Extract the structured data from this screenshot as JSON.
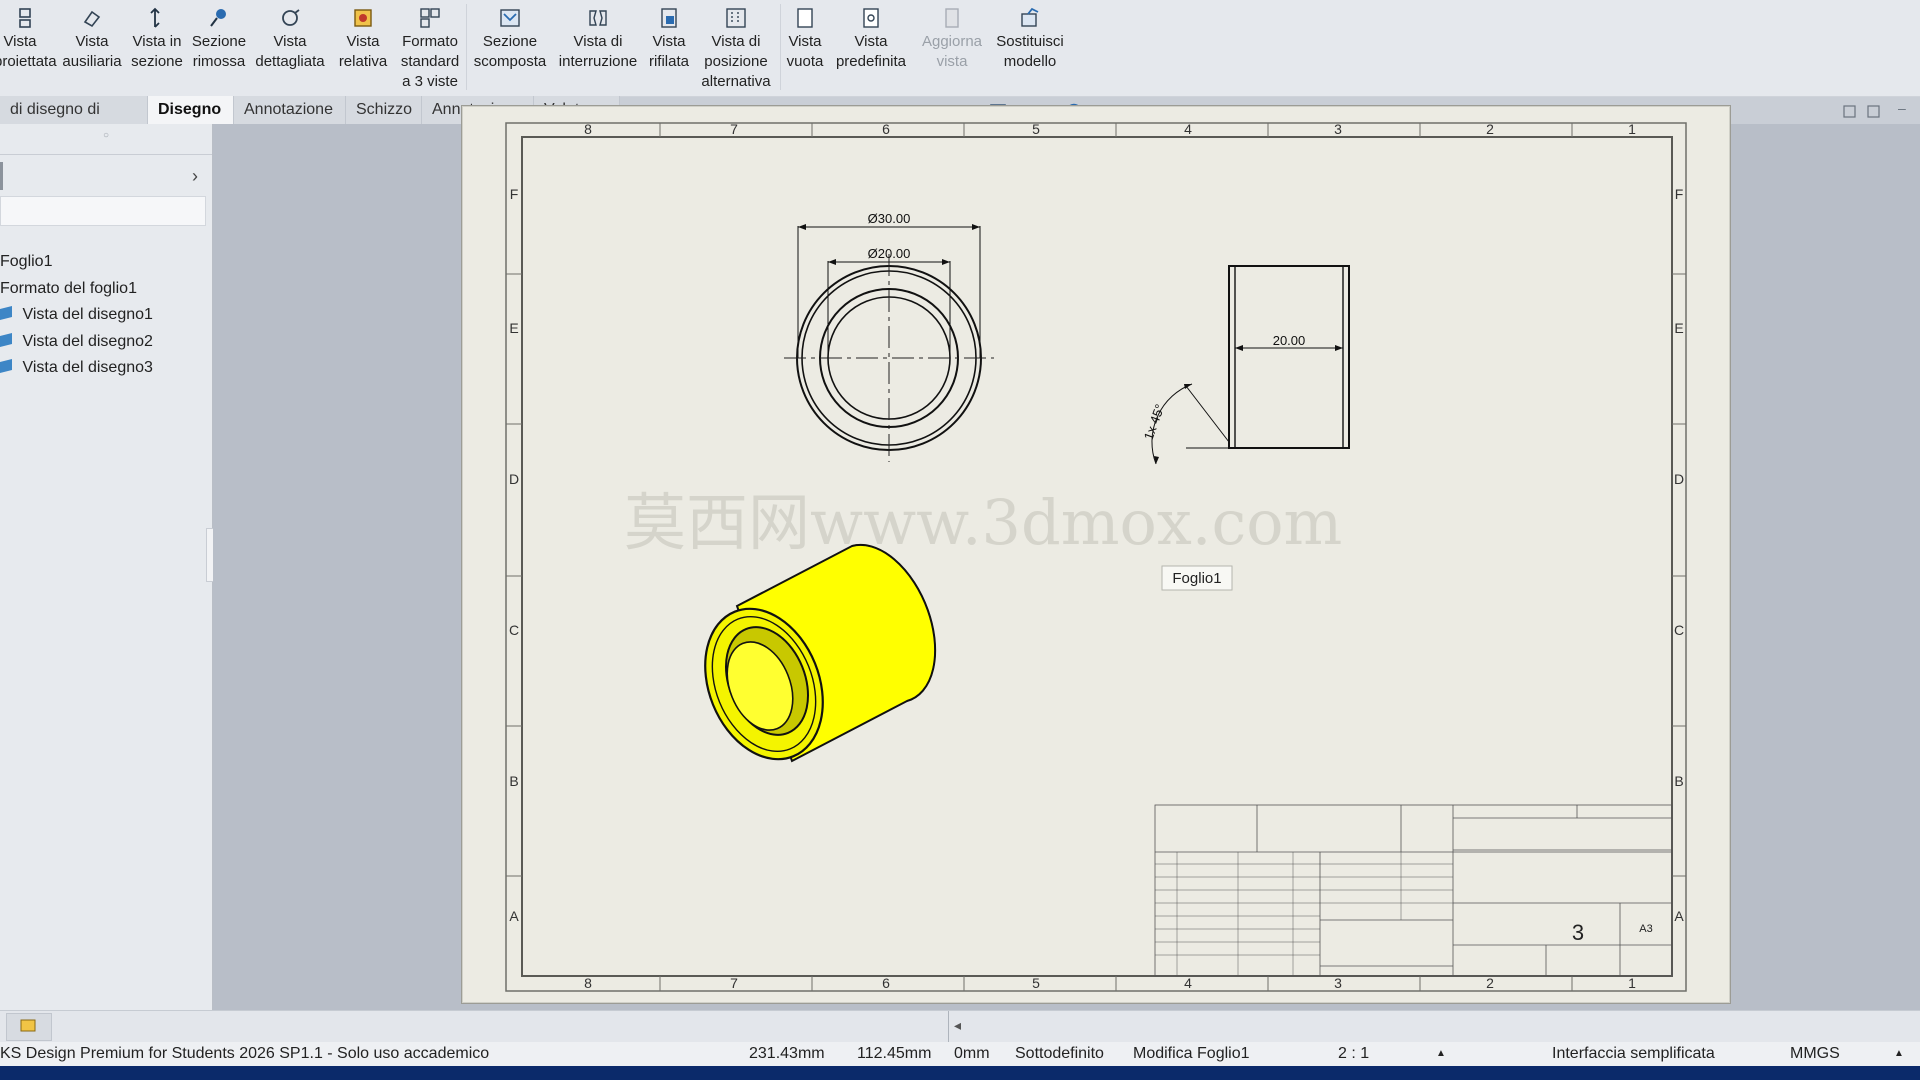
{
  "ribbon": {
    "buttons": [
      {
        "label": "Vista\nproiettata",
        "icon": "projected-view-icon"
      },
      {
        "label": "Vista\nausiliaria",
        "icon": "auxiliary-view-icon"
      },
      {
        "label": "Vista in\nsezione",
        "icon": "section-view-icon"
      },
      {
        "label": "Sezione\nrimossa",
        "icon": "removed-section-icon"
      },
      {
        "label": "Vista\ndettagliata",
        "icon": "detail-view-icon"
      },
      {
        "label": "Vista\nrelativa",
        "icon": "relative-view-icon"
      },
      {
        "label": "Formato\nstandard\na 3 viste",
        "icon": "standard-3-view-icon"
      },
      {
        "label": "Sezione\nscomposta",
        "icon": "broken-out-section-icon"
      },
      {
        "label": "Vista di\ninterruzione",
        "icon": "break-view-icon"
      },
      {
        "label": "Vista\nrifilata",
        "icon": "crop-view-icon"
      },
      {
        "label": "Vista di\nposizione\nalternativa",
        "icon": "alternate-position-view-icon"
      },
      {
        "label": "Vista\nvuota",
        "icon": "empty-view-icon"
      },
      {
        "label": "Vista\npredefinita",
        "icon": "predefined-view-icon"
      },
      {
        "label": "Aggiorna\nvista",
        "icon": "update-view-icon"
      },
      {
        "label": "Sostituisci\nmodello",
        "icon": "replace-model-icon"
      }
    ]
  },
  "tabs": [
    "di disegno di base",
    "Disegno",
    "Annotazione",
    "Schizzo",
    "Annotazione",
    "Valutare"
  ],
  "active_tab": "Disegno",
  "tree": {
    "items": [
      "Foglio1",
      "Formato del foglio1",
      "Vista del disegno1",
      "Vista del disegno2",
      "Vista del disegno3"
    ]
  },
  "sheet": {
    "col_labels": [
      "8",
      "7",
      "6",
      "5",
      "4",
      "3",
      "2",
      "1"
    ],
    "row_labels": [
      "F",
      "E",
      "D",
      "C",
      "B",
      "A"
    ],
    "dims": {
      "outer_dia": "Ø30.00",
      "inner_dia": "Ø20.00",
      "length": "20.00",
      "chamfer": "1x 45°"
    },
    "watermark": "莫西网www.3dmox.com",
    "sheet_tag": "Foglio1",
    "title_block": {
      "sheet_number": "3",
      "size": "A3"
    }
  },
  "status": {
    "app": "KS Design Premium for Students 2026 SP1.1 - Solo uso accademico",
    "x": "231.43mm",
    "y": "112.45mm",
    "z": "0mm",
    "definition": "Sottodefinito",
    "editing": "Modifica Foglio1",
    "scale": "2 : 1",
    "ui_mode": "Interfaccia semplificata",
    "units": "MMGS"
  },
  "colors": {
    "part_yellow": "#ffff00",
    "sheet_bg": "#ecebe3",
    "canvas_bg": "#b8bec8"
  }
}
